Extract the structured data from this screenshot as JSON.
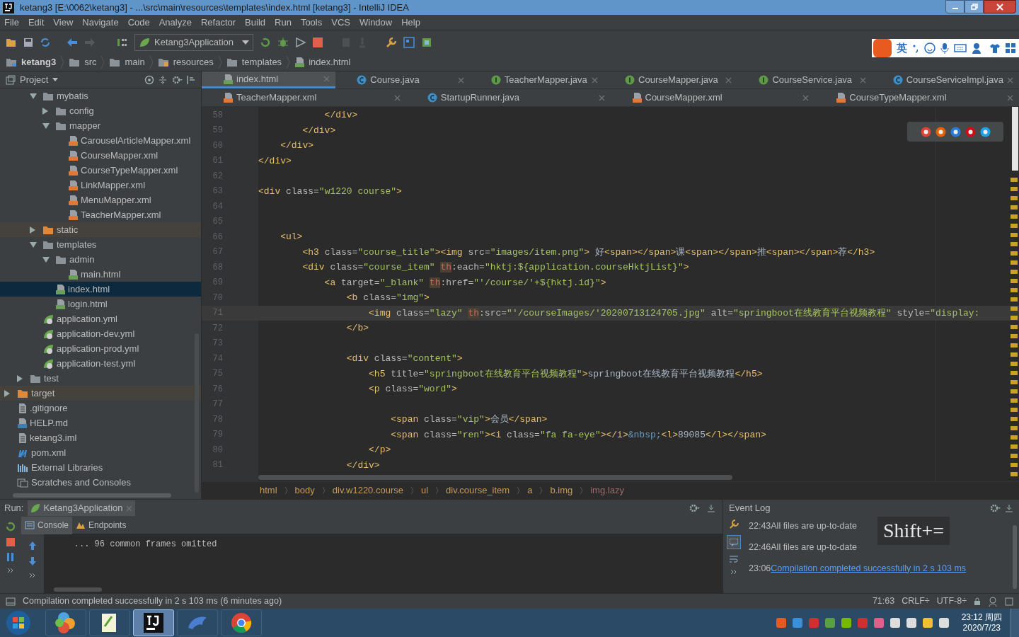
{
  "window": {
    "title": "ketang3 [E:\\0062\\ketang3] - ...\\src\\main\\resources\\templates\\index.html [ketang3] - IntelliJ IDEA"
  },
  "menu": [
    "File",
    "Edit",
    "View",
    "Navigate",
    "Code",
    "Analyze",
    "Refactor",
    "Build",
    "Run",
    "Tools",
    "VCS",
    "Window",
    "Help"
  ],
  "toolbar": {
    "run_config": "Ketang3Application"
  },
  "ime_bar": {
    "mode": "英"
  },
  "navigation_bar": [
    {
      "label": "ketang3",
      "kind": "module"
    },
    {
      "label": "src",
      "kind": "folder"
    },
    {
      "label": "main",
      "kind": "folder"
    },
    {
      "label": "resources",
      "kind": "resources"
    },
    {
      "label": "templates",
      "kind": "folder"
    },
    {
      "label": "index.html",
      "kind": "html"
    }
  ],
  "project_panel": {
    "title": "Project",
    "tree": [
      {
        "children": [
          {
            "children": [
              {
                "label": "mybatis",
                "kind": "folder",
                "expanded": true,
                "selected": false,
                "children": [
                  {
                    "label": "config",
                    "kind": "folder",
                    "expanded": false,
                    "selected": false
                  },
                  {
                    "label": "mapper",
                    "kind": "folder",
                    "expanded": true,
                    "selected": false,
                    "children": [
                      {
                        "label": "CarouselArticleMapper.xml",
                        "kind": "xml",
                        "selected": false
                      },
                      {
                        "label": "CourseMapper.xml",
                        "kind": "xml",
                        "selected": false
                      },
                      {
                        "label": "CourseTypeMapper.xml",
                        "kind": "xml",
                        "selected": false
                      },
                      {
                        "label": "LinkMapper.xml",
                        "kind": "xml",
                        "selected": false
                      },
                      {
                        "label": "MenuMapper.xml",
                        "kind": "xml",
                        "selected": false
                      },
                      {
                        "label": "TeacherMapper.xml",
                        "kind": "xml",
                        "selected": false
                      }
                    ]
                  }
                ]
              },
              {
                "label": "static",
                "kind": "folder-excluded",
                "expanded": false,
                "selected": false
              },
              {
                "label": "templates",
                "kind": "folder",
                "expanded": true,
                "selected": false,
                "children": [
                  {
                    "label": "admin",
                    "kind": "folder",
                    "expanded": true,
                    "selected": false,
                    "children": [
                      {
                        "label": "main.html",
                        "kind": "html",
                        "selected": false
                      }
                    ]
                  },
                  {
                    "label": "index.html",
                    "kind": "html",
                    "selected": true
                  },
                  {
                    "label": "login.html",
                    "kind": "html",
                    "selected": false
                  }
                ]
              },
              {
                "label": "application.yml",
                "kind": "yml",
                "selected": false
              },
              {
                "label": "application-dev.yml",
                "kind": "yml",
                "selected": false
              },
              {
                "label": "application-prod.yml",
                "kind": "yml",
                "selected": false
              },
              {
                "label": "application-test.yml",
                "kind": "yml",
                "selected": false
              }
            ]
          },
          {
            "label": "test",
            "kind": "folder",
            "expanded": false,
            "selected": false
          }
        ]
      },
      {
        "label": "target",
        "kind": "folder-excluded",
        "expanded": false,
        "selected": false
      },
      {
        "label": ".gitignore",
        "kind": "file",
        "selected": false
      },
      {
        "label": "HELP.md",
        "kind": "md",
        "selected": false
      },
      {
        "label": "ketang3.iml",
        "kind": "file",
        "selected": false
      },
      {
        "label": "pom.xml",
        "kind": "maven",
        "selected": false
      },
      {
        "label": "External Libraries",
        "kind": "libraries",
        "selected": false
      },
      {
        "label": "Scratches and Consoles",
        "kind": "scratches",
        "selected": false
      }
    ]
  },
  "tab_rows": [
    [
      {
        "label": "index.html",
        "kind": "html",
        "selected": true
      },
      {
        "label": "Course.java",
        "kind": "class",
        "selected": false
      },
      {
        "label": "TeacherMapper.java",
        "kind": "interface",
        "selected": false
      },
      {
        "label": "CourseMapper.java",
        "kind": "interface",
        "selected": false
      },
      {
        "label": "CourseService.java",
        "kind": "interface",
        "selected": false
      },
      {
        "label": "CourseServiceImpl.java",
        "kind": "class",
        "selected": false
      }
    ],
    [
      {
        "label": "TeacherMapper.xml",
        "kind": "xml",
        "selected": false
      },
      {
        "label": "StartupRunner.java",
        "kind": "class",
        "selected": false
      },
      {
        "label": "CourseMapper.xml",
        "kind": "xml",
        "selected": false
      },
      {
        "label": "CourseTypeMapper.xml",
        "kind": "xml",
        "selected": false
      }
    ]
  ],
  "editor": {
    "lines": [
      {
        "number": "58",
        "current": false,
        "tokens": [
          {
            "kind": "tag",
            "text": "            </div>"
          }
        ]
      },
      {
        "number": "59",
        "current": false,
        "tokens": [
          {
            "kind": "tag",
            "text": "        </div>"
          }
        ]
      },
      {
        "number": "60",
        "current": false,
        "tokens": [
          {
            "kind": "tag",
            "text": "    </div>"
          }
        ]
      },
      {
        "number": "61",
        "current": false,
        "tokens": [
          {
            "kind": "tag",
            "text": "</div>"
          }
        ]
      },
      {
        "number": "62",
        "current": false
      },
      {
        "number": "63",
        "current": false,
        "tokens": [
          {
            "kind": "tag",
            "text": "<div"
          },
          {
            "kind": "attr",
            "text": " class="
          },
          {
            "kind": "str",
            "text": "\"w1220 course\""
          },
          {
            "kind": "tag",
            "text": ">"
          }
        ]
      },
      {
        "number": "64",
        "current": false
      },
      {
        "number": "65",
        "current": false
      },
      {
        "number": "66",
        "current": false,
        "tokens": [
          {
            "kind": "tag",
            "text": "    <ul>"
          }
        ]
      },
      {
        "number": "67",
        "current": false,
        "tokens": [
          {
            "kind": "tag",
            "text": "        <h3"
          },
          {
            "kind": "attr",
            "text": " class="
          },
          {
            "kind": "str",
            "text": "\"course_title\""
          },
          {
            "kind": "tag",
            "text": "><img"
          },
          {
            "kind": "attr",
            "text": " src="
          },
          {
            "kind": "str",
            "text": "\"images/item.png\""
          },
          {
            "kind": "tag",
            "text": ">"
          },
          {
            "kind": "text",
            "text": " 好"
          },
          {
            "kind": "tag",
            "text": "<span></span>"
          },
          {
            "kind": "text",
            "text": "课"
          },
          {
            "kind": "tag",
            "text": "<span></span>"
          },
          {
            "kind": "text",
            "text": "推"
          },
          {
            "kind": "tag",
            "text": "<span></span>"
          },
          {
            "kind": "text",
            "text": "荐"
          },
          {
            "kind": "tag",
            "text": "</h3>"
          }
        ]
      },
      {
        "number": "68",
        "current": false,
        "tokens": [
          {
            "kind": "tag",
            "text": "        <div"
          },
          {
            "kind": "attr",
            "text": " class="
          },
          {
            "kind": "str",
            "text": "\"course_item\" "
          },
          {
            "kind": "ns",
            "text": "th"
          },
          {
            "kind": "attr",
            "text": ":each="
          },
          {
            "kind": "str",
            "text": "\"hktj:${application.courseHktjList}\""
          },
          {
            "kind": "tag",
            "text": ">"
          }
        ]
      },
      {
        "number": "69",
        "current": false,
        "tokens": [
          {
            "kind": "tag",
            "text": "            <a"
          },
          {
            "kind": "attr",
            "text": " target="
          },
          {
            "kind": "str",
            "text": "\"_blank\" "
          },
          {
            "kind": "ns",
            "text": "th"
          },
          {
            "kind": "attr",
            "text": ":href="
          },
          {
            "kind": "str",
            "text": "\"'/course/'+${hktj.id}\""
          },
          {
            "kind": "tag",
            "text": ">"
          }
        ]
      },
      {
        "number": "70",
        "current": false,
        "tokens": [
          {
            "kind": "tag",
            "text": "                <b"
          },
          {
            "kind": "attr",
            "text": " class="
          },
          {
            "kind": "str",
            "text": "\"img\""
          },
          {
            "kind": "tag",
            "text": ">"
          }
        ]
      },
      {
        "number": "71",
        "current": true,
        "tokens": [
          {
            "kind": "tag",
            "text": "                    <img"
          },
          {
            "kind": "attr",
            "text": " class="
          },
          {
            "kind": "str",
            "text": "\"lazy\" "
          },
          {
            "kind": "ns",
            "text": "th"
          },
          {
            "kind": "attr",
            "text": ":src="
          },
          {
            "kind": "str",
            "text": "\"'/courseImages/'20200713124705.jpg\""
          },
          {
            "kind": "attr",
            "text": " alt="
          },
          {
            "kind": "str",
            "text": "\"springboot在线教育平台视频教程\""
          },
          {
            "kind": "attr",
            "text": " style="
          },
          {
            "kind": "str",
            "text": "\"display:"
          }
        ]
      },
      {
        "number": "72",
        "current": false,
        "tokens": [
          {
            "kind": "tag",
            "text": "                </b>"
          }
        ]
      },
      {
        "number": "73",
        "current": false
      },
      {
        "number": "74",
        "current": false,
        "tokens": [
          {
            "kind": "tag",
            "text": "                <div"
          },
          {
            "kind": "attr",
            "text": " class="
          },
          {
            "kind": "str",
            "text": "\"content\""
          },
          {
            "kind": "tag",
            "text": ">"
          }
        ]
      },
      {
        "number": "75",
        "current": false,
        "tokens": [
          {
            "kind": "tag",
            "text": "                    <h5"
          },
          {
            "kind": "attr",
            "text": " title="
          },
          {
            "kind": "str",
            "text": "\"springboot在线教育平台视频教程\""
          },
          {
            "kind": "tag",
            "text": ">"
          },
          {
            "kind": "text",
            "text": "springboot在线教育平台视频教程"
          },
          {
            "kind": "tag",
            "text": "</h5>"
          }
        ]
      },
      {
        "number": "76",
        "current": false,
        "tokens": [
          {
            "kind": "tag",
            "text": "                    <p"
          },
          {
            "kind": "attr",
            "text": " class="
          },
          {
            "kind": "str",
            "text": "\"word\""
          },
          {
            "kind": "tag",
            "text": ">"
          }
        ]
      },
      {
        "number": "77",
        "current": false
      },
      {
        "number": "78",
        "current": false,
        "tokens": [
          {
            "kind": "tag",
            "text": "                        <span"
          },
          {
            "kind": "attr",
            "text": " class="
          },
          {
            "kind": "str",
            "text": "\"vip\""
          },
          {
            "kind": "tag",
            "text": ">"
          },
          {
            "kind": "text",
            "text": "会员"
          },
          {
            "kind": "tag",
            "text": "</span>"
          }
        ]
      },
      {
        "number": "79",
        "current": false,
        "tokens": [
          {
            "kind": "tag",
            "text": "                        <span"
          },
          {
            "kind": "attr",
            "text": " class="
          },
          {
            "kind": "str",
            "text": "\"ren\""
          },
          {
            "kind": "tag",
            "text": "><i"
          },
          {
            "kind": "attr",
            "text": " class="
          },
          {
            "kind": "str",
            "text": "\"fa fa-eye\""
          },
          {
            "kind": "tag",
            "text": "></i>"
          },
          {
            "kind": "ent",
            "text": "&nbsp;"
          },
          {
            "kind": "tag",
            "text": "<l>"
          },
          {
            "kind": "text",
            "text": "89085"
          },
          {
            "kind": "tag",
            "text": "</l></span>"
          }
        ]
      },
      {
        "number": "80",
        "current": false,
        "tokens": [
          {
            "kind": "tag",
            "text": "                    </p>"
          }
        ]
      },
      {
        "number": "81",
        "current": false,
        "tokens": [
          {
            "kind": "tag",
            "text": "                </div>"
          }
        ]
      }
    ]
  },
  "editor_breadcrumbs": [
    "html",
    "body",
    "div.w1220.course",
    "ul",
    "div.course_item",
    "a",
    "b.img",
    "img.lazy"
  ],
  "run_panel": {
    "label": "Run:",
    "config_tab": "Ketang3Application",
    "tabs": [
      {
        "label": "Console",
        "selected": true
      },
      {
        "label": "Endpoints",
        "selected": false
      }
    ],
    "console_lines": [
      "    ... 96 common frames omitted"
    ]
  },
  "event_log": {
    "title": "Event Log",
    "entries": [
      {
        "time": "22:43",
        "message": "All files are up-to-date",
        "kind": "text"
      },
      {
        "time": "22:46",
        "message": "All files are up-to-date",
        "kind": "text"
      },
      {
        "time": "23:06",
        "message": "Compilation completed successfully in 2 s 103 ms",
        "kind": "link"
      }
    ],
    "key_overlay": "Shift+="
  },
  "status_bar": {
    "message": "Compilation completed successfully in 2 s 103 ms (6 minutes ago)",
    "position": "71:63",
    "line_separator": "CRLF÷",
    "encoding": "UTF-8÷"
  },
  "taskbar": {
    "apps": [
      {
        "kind": "pinwheel",
        "selected": false
      },
      {
        "kind": "notepad",
        "selected": false
      },
      {
        "kind": "ide",
        "selected": true
      },
      {
        "kind": "dolphin",
        "selected": false
      },
      {
        "kind": "chrome",
        "selected": false
      }
    ],
    "time": "23:12 周四",
    "date": "2020/7/23"
  }
}
